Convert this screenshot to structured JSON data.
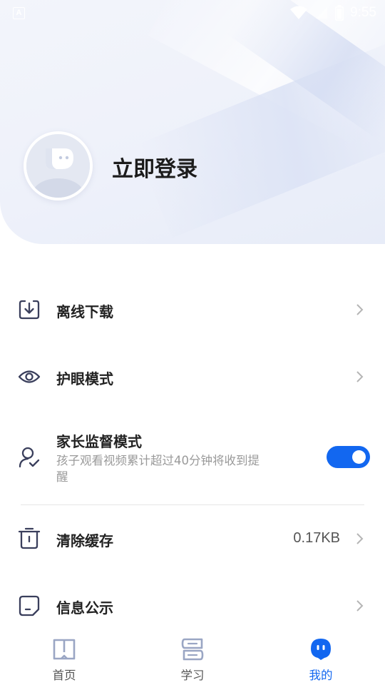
{
  "status_bar": {
    "time": "9:55",
    "notification_icon": "A"
  },
  "profile": {
    "login_label": "立即登录"
  },
  "menu": {
    "offline_download": {
      "label": "离线下载",
      "icon": "download-box-icon"
    },
    "eye_care": {
      "label": "护眼模式",
      "icon": "eye-icon"
    },
    "parental": {
      "label": "家长监督模式",
      "description": "孩子观看视频累计超过40分钟将收到提醒",
      "icon": "parent-check-icon",
      "enabled": true
    },
    "clear_cache": {
      "label": "清除缓存",
      "value": "0.17KB",
      "icon": "trash-icon"
    },
    "info": {
      "label": "信息公示",
      "icon": "document-icon"
    }
  },
  "tabs": [
    {
      "label": "首页",
      "icon": "book-icon",
      "active": false
    },
    {
      "label": "学习",
      "icon": "study-stack-icon",
      "active": false
    },
    {
      "label": "我的",
      "icon": "mascot-face-icon",
      "active": true
    }
  ],
  "colors": {
    "accent": "#1267f0",
    "icon_stroke": "#3a3f5c"
  }
}
